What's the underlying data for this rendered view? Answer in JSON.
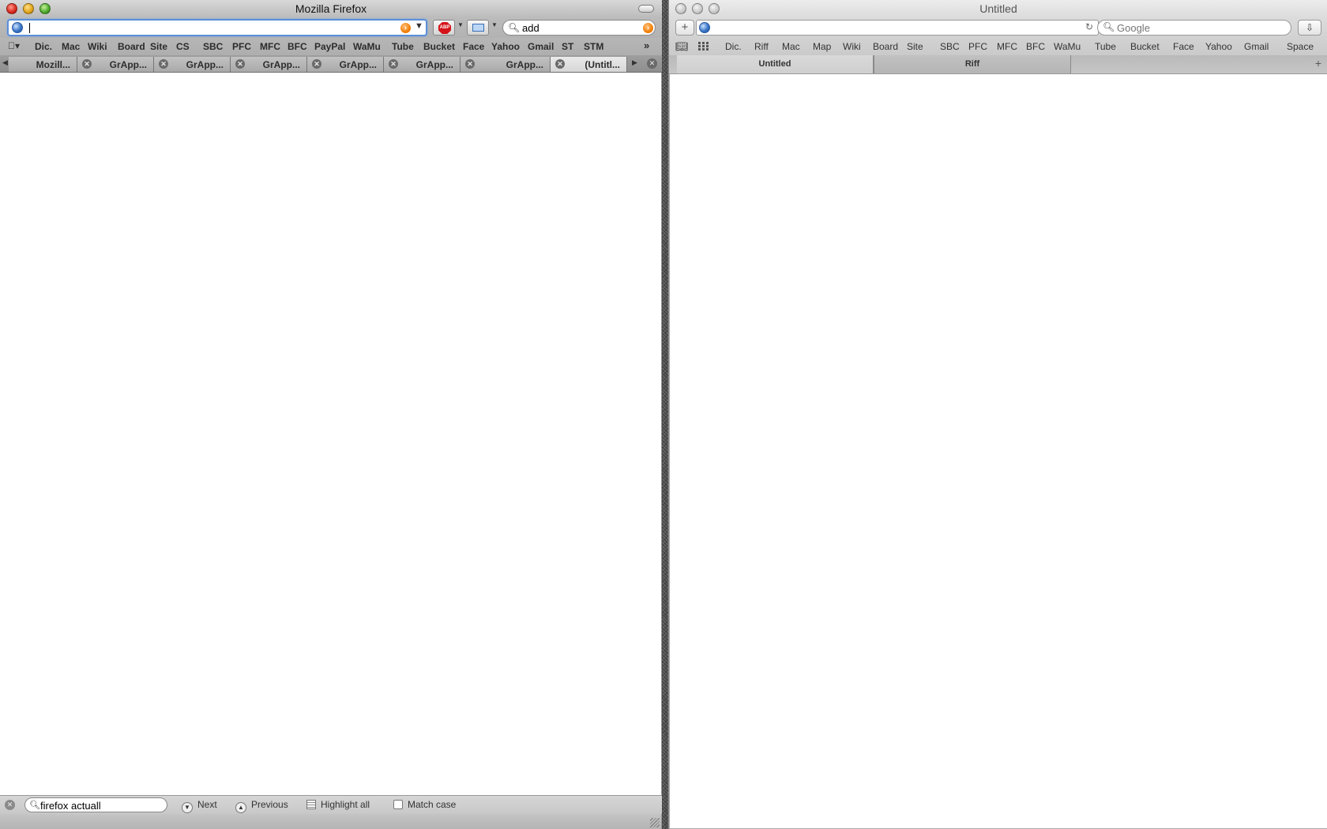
{
  "firefox": {
    "title": "Mozilla Firefox",
    "url_value": "",
    "search_value": "add",
    "bookmarks": [
      "Dic.",
      "Mac",
      "Wiki",
      "Board",
      "Site",
      "CS",
      "SBC",
      "PFC",
      "MFC",
      "BFC",
      "PayPal",
      "WaMu",
      "Tube",
      "Bucket",
      "Face",
      "Yahoo",
      "Gmail",
      "ST",
      "STM"
    ],
    "tabs": [
      "Mozill...",
      "GrApp...",
      "GrApp...",
      "GrApp...",
      "GrApp...",
      "GrApp...",
      "GrApp...",
      "(Untitl..."
    ],
    "find_bar": {
      "query": "firefox actuall",
      "next_label": "Next",
      "previous_label": "Previous",
      "highlight_label": "Highlight all",
      "match_case_label": "Match case"
    }
  },
  "safari": {
    "title": "Untitled",
    "url_value": "",
    "search_placeholder": "Google",
    "bookmarks": [
      "Dic.",
      "Riff",
      "Mac",
      "Map",
      "Wiki",
      "Board",
      "Site",
      "SBC",
      "PFC",
      "MFC",
      "BFC",
      "WaMu",
      "Tube",
      "Bucket",
      "Face",
      "Yahoo",
      "Gmail",
      "Space"
    ],
    "tabs": [
      "Untitled",
      "Riff"
    ]
  },
  "icons": {
    "close": "close-icon",
    "search": "search-icon",
    "globe": "globe-icon",
    "reload": "reload-icon",
    "adblock": "adblock-icon"
  }
}
